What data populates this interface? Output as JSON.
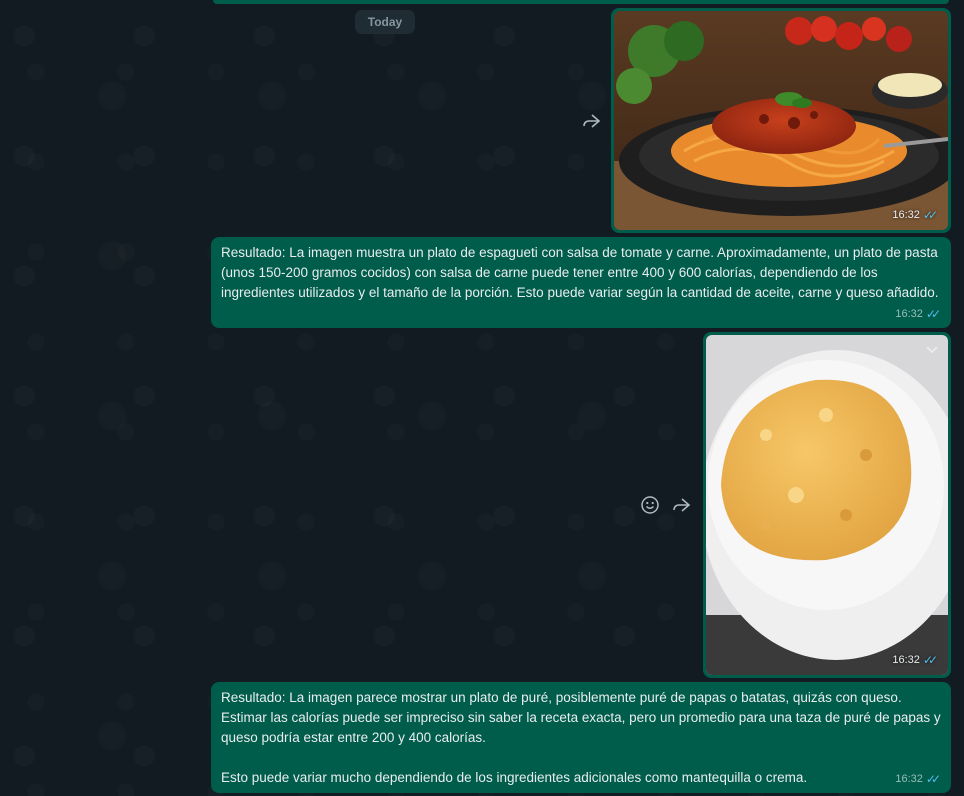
{
  "chat": {
    "date_divider": "Today",
    "messages": [
      {
        "type": "image",
        "subject": "spaghetti-bolognese",
        "time": "16:32",
        "status": "read"
      },
      {
        "type": "text",
        "text": "Resultado: La imagen muestra un plato de espagueti con salsa de tomate y carne. Aproximadamente, un plato de pasta (unos 150-200 gramos cocidos) con salsa de carne puede tener entre 400 y 600 calorías, dependiendo de los ingredientes utilizados y el tamaño de la porción. Esto puede variar según la cantidad de aceite, carne y queso añadido.",
        "time": "16:32",
        "status": "read"
      },
      {
        "type": "image",
        "subject": "mashed-potatoes",
        "time": "16:32",
        "status": "read"
      },
      {
        "type": "text",
        "text": "Resultado: La imagen parece mostrar un plato de puré, posiblemente puré de papas o batatas, quizás con queso. Estimar las calorías puede ser impreciso sin saber la receta exacta, pero un promedio para una taza de puré de papas y queso podría estar entre 200 y 400 calorías.\n\nEsto puede variar mucho dependiendo de los ingredientes adicionales como mantequilla o crema.",
        "time": "16:32",
        "status": "read"
      }
    ]
  },
  "icons": {
    "forward": "forward-icon",
    "emoji": "emoji-icon",
    "menu": "chevron-down-icon",
    "read_receipt": "double-check-icon"
  },
  "colors": {
    "outgoing_bubble": "#005c4b",
    "background": "#0b141a",
    "read_check": "#53bdeb"
  }
}
